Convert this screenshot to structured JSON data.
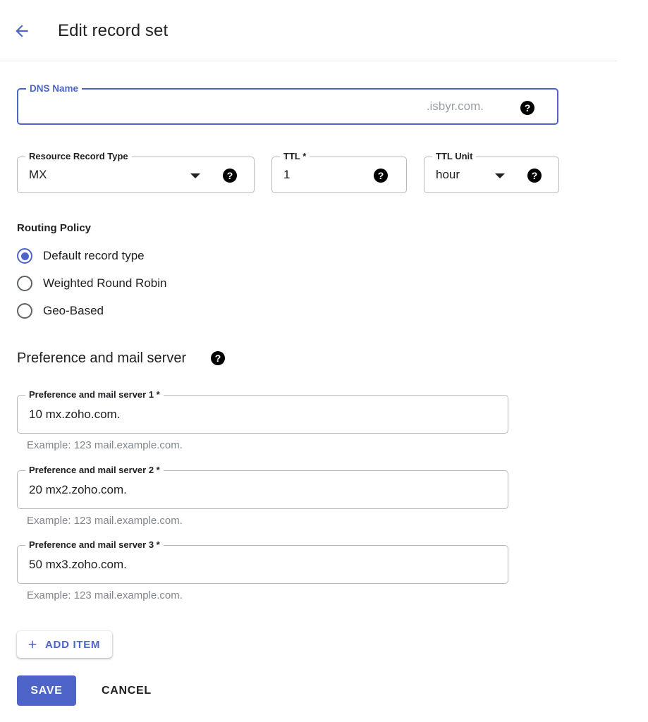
{
  "header": {
    "back_icon": "arrow-left-icon",
    "title": "Edit record set"
  },
  "colors": {
    "accent": "#4e64c8",
    "field_border": "#b6b9bd",
    "hint_text": "#80868b",
    "help_icon_bg": "#000000"
  },
  "form": {
    "dns_name": {
      "label": "DNS Name",
      "value": "",
      "suffix": ".isbyr.com.",
      "help_icon": "help-icon",
      "focused": true
    },
    "record_type": {
      "label": "Resource Record Type",
      "value": "MX",
      "help_icon": "help-icon",
      "caret_icon": "chevron-down-icon"
    },
    "ttl": {
      "label": "TTL *",
      "value": "1",
      "help_icon": "help-icon"
    },
    "ttl_unit": {
      "label": "TTL Unit",
      "value": "hour",
      "help_icon": "help-icon",
      "caret_icon": "chevron-down-icon"
    },
    "routing_policy": {
      "heading": "Routing Policy",
      "options": [
        {
          "label": "Default record type",
          "checked": true
        },
        {
          "label": "Weighted Round Robin",
          "checked": false
        },
        {
          "label": "Geo-Based",
          "checked": false
        }
      ]
    },
    "preference_group": {
      "title": "Preference and mail server",
      "help_icon": "help-icon",
      "items": [
        {
          "label": "Preference and mail server 1 *",
          "value": "10 mx.zoho.com.",
          "hint": "Example: 123 mail.example.com."
        },
        {
          "label": "Preference and mail server 2 *",
          "value": "20 mx2.zoho.com.",
          "hint": "Example: 123 mail.example.com."
        },
        {
          "label": "Preference and mail server 3 *",
          "value": "50 mx3.zoho.com.",
          "hint": "Example: 123 mail.example.com."
        }
      ]
    }
  },
  "actions": {
    "add_item": {
      "label": "ADD ITEM",
      "icon": "plus-icon"
    },
    "save": {
      "label": "SAVE"
    },
    "cancel": {
      "label": "CANCEL"
    }
  }
}
